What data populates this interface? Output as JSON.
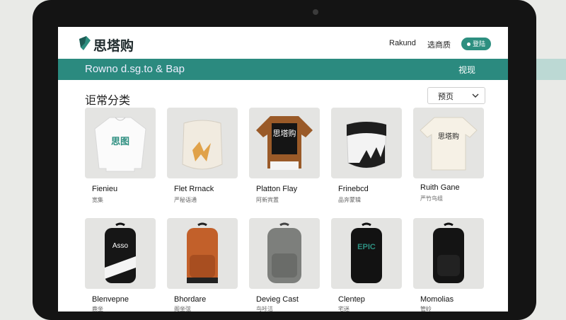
{
  "header": {
    "logo_text": "思塔购",
    "nav": [
      "Rakund",
      "选商质"
    ],
    "pill_label": "登陆"
  },
  "search": {
    "text": "Rowno d.sg.to & Bap",
    "button_label": "视现"
  },
  "section": {
    "title": "讵常分类",
    "sort_label": "预页"
  },
  "products_row1": [
    {
      "name": "Fienieu",
      "sub": "宽集"
    },
    {
      "name": "Flet Rrnack",
      "sub": "严秘语通"
    },
    {
      "name": "Platton Flay",
      "sub": "阿新宾置"
    },
    {
      "name": "Frinebcd",
      "sub": "品奔蒙辑"
    },
    {
      "name": "Ruith Gane",
      "sub": "严竹鸟组"
    }
  ],
  "products_row2": [
    {
      "name": "Blenvepne",
      "sub": "鹿坐"
    },
    {
      "name": "Bhordare",
      "sub": "阁坐弦"
    },
    {
      "name": "Devieg Cast",
      "sub": "鸟咔洁"
    },
    {
      "name": "Clentep",
      "sub": "宅迷"
    },
    {
      "name": "Momolias",
      "sub": "管岭"
    }
  ],
  "print_labels": {
    "shirt1": "思图",
    "shirt4": "思塔购",
    "shirt3": "思塔购",
    "bag1": "Asso",
    "bag4": "EPIC"
  },
  "colors": {
    "brand_teal": "#2b8a7f",
    "frame": "#141414"
  }
}
